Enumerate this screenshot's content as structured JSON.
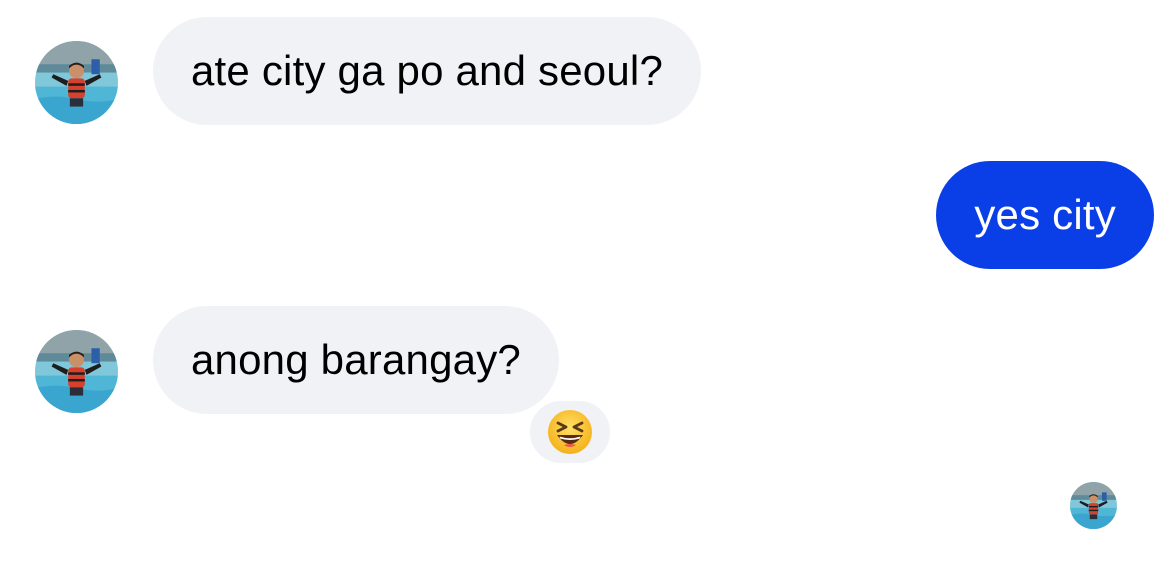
{
  "messages": [
    {
      "direction": "incoming",
      "text": "ate city ga po and seoul?"
    },
    {
      "direction": "outgoing",
      "text": "yes city"
    },
    {
      "direction": "incoming",
      "text": "anong barangay?",
      "reaction": "grinning-squinting-face-emoji"
    }
  ],
  "avatar_icon": "swimming-child-avatar",
  "read_receipt_icon": "read-receipt-avatar",
  "colors": {
    "incoming_bubble": "#f1f2f6",
    "outgoing_bubble": "#0a3fe8",
    "incoming_text": "#000000",
    "outgoing_text": "#ffffff",
    "background": "#ffffff"
  }
}
